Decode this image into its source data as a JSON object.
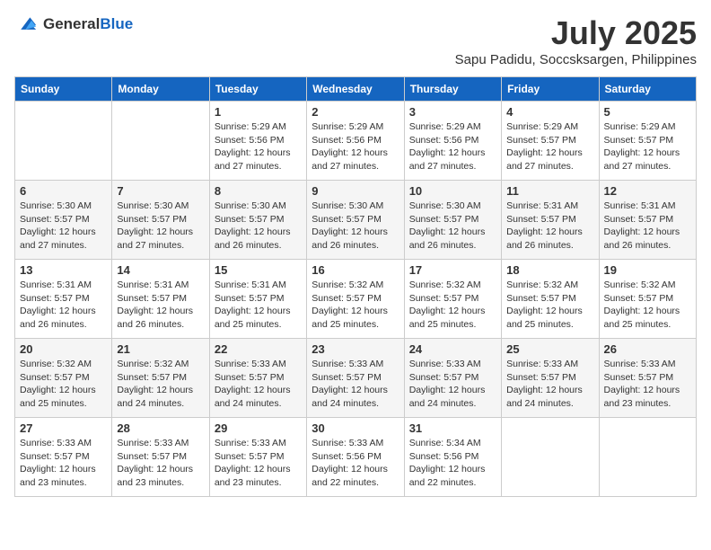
{
  "header": {
    "logo": {
      "general": "General",
      "blue": "Blue"
    },
    "month": "July 2025",
    "location": "Sapu Padidu, Soccsksargen, Philippines"
  },
  "days_of_week": [
    "Sunday",
    "Monday",
    "Tuesday",
    "Wednesday",
    "Thursday",
    "Friday",
    "Saturday"
  ],
  "weeks": [
    [
      {
        "day": "",
        "sunrise": "",
        "sunset": "",
        "daylight": ""
      },
      {
        "day": "",
        "sunrise": "",
        "sunset": "",
        "daylight": ""
      },
      {
        "day": "1",
        "sunrise": "Sunrise: 5:29 AM",
        "sunset": "Sunset: 5:56 PM",
        "daylight": "Daylight: 12 hours and 27 minutes."
      },
      {
        "day": "2",
        "sunrise": "Sunrise: 5:29 AM",
        "sunset": "Sunset: 5:56 PM",
        "daylight": "Daylight: 12 hours and 27 minutes."
      },
      {
        "day": "3",
        "sunrise": "Sunrise: 5:29 AM",
        "sunset": "Sunset: 5:56 PM",
        "daylight": "Daylight: 12 hours and 27 minutes."
      },
      {
        "day": "4",
        "sunrise": "Sunrise: 5:29 AM",
        "sunset": "Sunset: 5:57 PM",
        "daylight": "Daylight: 12 hours and 27 minutes."
      },
      {
        "day": "5",
        "sunrise": "Sunrise: 5:29 AM",
        "sunset": "Sunset: 5:57 PM",
        "daylight": "Daylight: 12 hours and 27 minutes."
      }
    ],
    [
      {
        "day": "6",
        "sunrise": "Sunrise: 5:30 AM",
        "sunset": "Sunset: 5:57 PM",
        "daylight": "Daylight: 12 hours and 27 minutes."
      },
      {
        "day": "7",
        "sunrise": "Sunrise: 5:30 AM",
        "sunset": "Sunset: 5:57 PM",
        "daylight": "Daylight: 12 hours and 27 minutes."
      },
      {
        "day": "8",
        "sunrise": "Sunrise: 5:30 AM",
        "sunset": "Sunset: 5:57 PM",
        "daylight": "Daylight: 12 hours and 26 minutes."
      },
      {
        "day": "9",
        "sunrise": "Sunrise: 5:30 AM",
        "sunset": "Sunset: 5:57 PM",
        "daylight": "Daylight: 12 hours and 26 minutes."
      },
      {
        "day": "10",
        "sunrise": "Sunrise: 5:30 AM",
        "sunset": "Sunset: 5:57 PM",
        "daylight": "Daylight: 12 hours and 26 minutes."
      },
      {
        "day": "11",
        "sunrise": "Sunrise: 5:31 AM",
        "sunset": "Sunset: 5:57 PM",
        "daylight": "Daylight: 12 hours and 26 minutes."
      },
      {
        "day": "12",
        "sunrise": "Sunrise: 5:31 AM",
        "sunset": "Sunset: 5:57 PM",
        "daylight": "Daylight: 12 hours and 26 minutes."
      }
    ],
    [
      {
        "day": "13",
        "sunrise": "Sunrise: 5:31 AM",
        "sunset": "Sunset: 5:57 PM",
        "daylight": "Daylight: 12 hours and 26 minutes."
      },
      {
        "day": "14",
        "sunrise": "Sunrise: 5:31 AM",
        "sunset": "Sunset: 5:57 PM",
        "daylight": "Daylight: 12 hours and 26 minutes."
      },
      {
        "day": "15",
        "sunrise": "Sunrise: 5:31 AM",
        "sunset": "Sunset: 5:57 PM",
        "daylight": "Daylight: 12 hours and 25 minutes."
      },
      {
        "day": "16",
        "sunrise": "Sunrise: 5:32 AM",
        "sunset": "Sunset: 5:57 PM",
        "daylight": "Daylight: 12 hours and 25 minutes."
      },
      {
        "day": "17",
        "sunrise": "Sunrise: 5:32 AM",
        "sunset": "Sunset: 5:57 PM",
        "daylight": "Daylight: 12 hours and 25 minutes."
      },
      {
        "day": "18",
        "sunrise": "Sunrise: 5:32 AM",
        "sunset": "Sunset: 5:57 PM",
        "daylight": "Daylight: 12 hours and 25 minutes."
      },
      {
        "day": "19",
        "sunrise": "Sunrise: 5:32 AM",
        "sunset": "Sunset: 5:57 PM",
        "daylight": "Daylight: 12 hours and 25 minutes."
      }
    ],
    [
      {
        "day": "20",
        "sunrise": "Sunrise: 5:32 AM",
        "sunset": "Sunset: 5:57 PM",
        "daylight": "Daylight: 12 hours and 25 minutes."
      },
      {
        "day": "21",
        "sunrise": "Sunrise: 5:32 AM",
        "sunset": "Sunset: 5:57 PM",
        "daylight": "Daylight: 12 hours and 24 minutes."
      },
      {
        "day": "22",
        "sunrise": "Sunrise: 5:33 AM",
        "sunset": "Sunset: 5:57 PM",
        "daylight": "Daylight: 12 hours and 24 minutes."
      },
      {
        "day": "23",
        "sunrise": "Sunrise: 5:33 AM",
        "sunset": "Sunset: 5:57 PM",
        "daylight": "Daylight: 12 hours and 24 minutes."
      },
      {
        "day": "24",
        "sunrise": "Sunrise: 5:33 AM",
        "sunset": "Sunset: 5:57 PM",
        "daylight": "Daylight: 12 hours and 24 minutes."
      },
      {
        "day": "25",
        "sunrise": "Sunrise: 5:33 AM",
        "sunset": "Sunset: 5:57 PM",
        "daylight": "Daylight: 12 hours and 24 minutes."
      },
      {
        "day": "26",
        "sunrise": "Sunrise: 5:33 AM",
        "sunset": "Sunset: 5:57 PM",
        "daylight": "Daylight: 12 hours and 23 minutes."
      }
    ],
    [
      {
        "day": "27",
        "sunrise": "Sunrise: 5:33 AM",
        "sunset": "Sunset: 5:57 PM",
        "daylight": "Daylight: 12 hours and 23 minutes."
      },
      {
        "day": "28",
        "sunrise": "Sunrise: 5:33 AM",
        "sunset": "Sunset: 5:57 PM",
        "daylight": "Daylight: 12 hours and 23 minutes."
      },
      {
        "day": "29",
        "sunrise": "Sunrise: 5:33 AM",
        "sunset": "Sunset: 5:57 PM",
        "daylight": "Daylight: 12 hours and 23 minutes."
      },
      {
        "day": "30",
        "sunrise": "Sunrise: 5:33 AM",
        "sunset": "Sunset: 5:56 PM",
        "daylight": "Daylight: 12 hours and 22 minutes."
      },
      {
        "day": "31",
        "sunrise": "Sunrise: 5:34 AM",
        "sunset": "Sunset: 5:56 PM",
        "daylight": "Daylight: 12 hours and 22 minutes."
      },
      {
        "day": "",
        "sunrise": "",
        "sunset": "",
        "daylight": ""
      },
      {
        "day": "",
        "sunrise": "",
        "sunset": "",
        "daylight": ""
      }
    ]
  ]
}
